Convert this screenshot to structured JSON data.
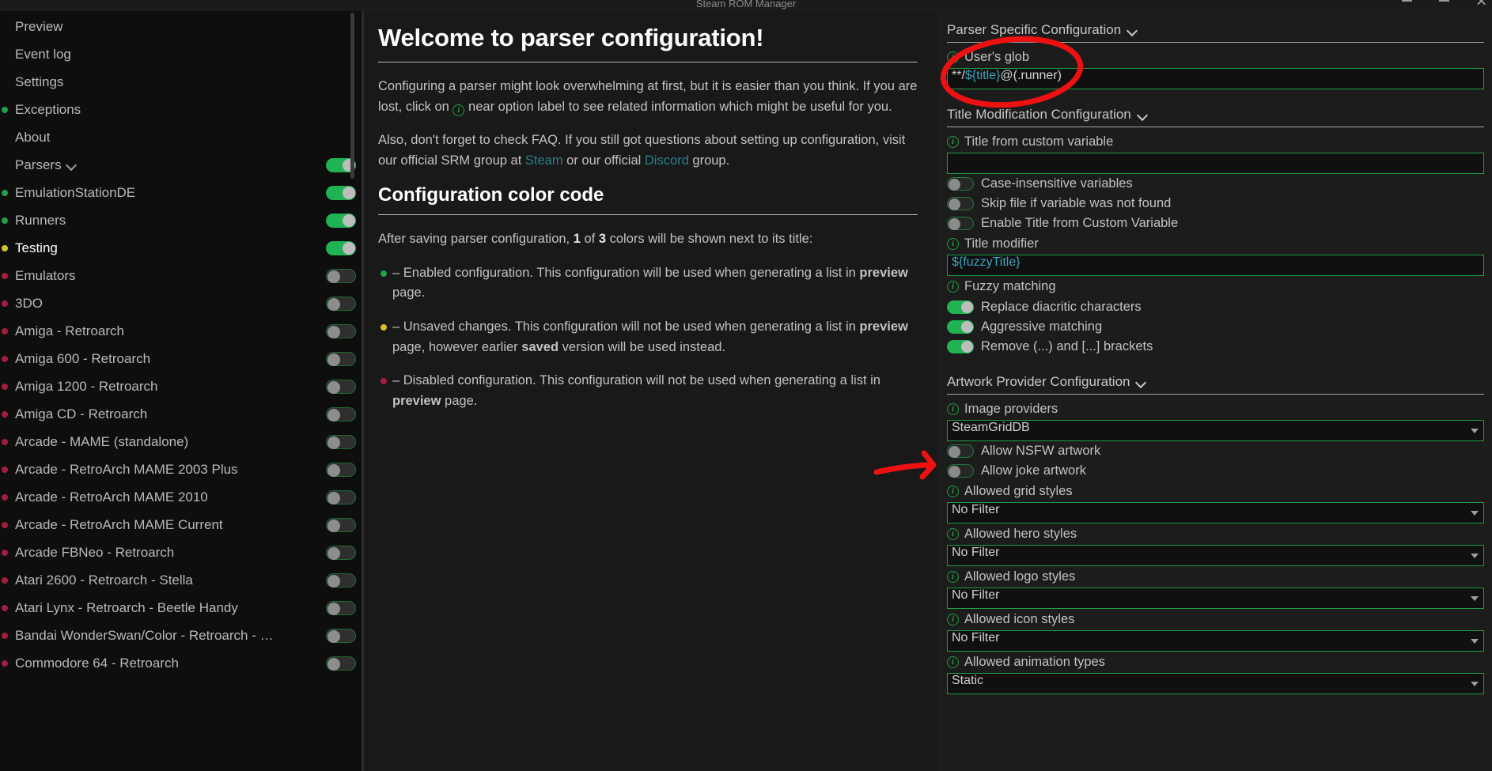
{
  "window": {
    "title": "Steam ROM Manager",
    "controls": [
      "minimize-button",
      "maximize-button",
      "close-button"
    ]
  },
  "sidebar": {
    "items": [
      {
        "label": "Preview",
        "dot": "none",
        "toggle": "none",
        "active": false
      },
      {
        "label": "Event log",
        "dot": "none",
        "toggle": "none",
        "active": false
      },
      {
        "label": "Settings",
        "dot": "none",
        "toggle": "none",
        "active": false
      },
      {
        "label": "Exceptions",
        "dot": "green",
        "toggle": "none",
        "active": false
      },
      {
        "label": "About",
        "dot": "none",
        "toggle": "none",
        "active": false
      },
      {
        "label": "Parsers",
        "dot": "none",
        "toggle": "on",
        "active": false,
        "chevron": true
      },
      {
        "label": "EmulationStationDE",
        "dot": "green",
        "toggle": "on",
        "active": false
      },
      {
        "label": "Runners",
        "dot": "green",
        "toggle": "on",
        "active": false
      },
      {
        "label": "Testing",
        "dot": "yellow",
        "toggle": "on",
        "active": true
      },
      {
        "label": "Emulators",
        "dot": "red",
        "toggle": "off",
        "active": false
      },
      {
        "label": "3DO",
        "dot": "red",
        "toggle": "off",
        "active": false
      },
      {
        "label": "Amiga - Retroarch",
        "dot": "red",
        "toggle": "off",
        "active": false
      },
      {
        "label": "Amiga 600 - Retroarch",
        "dot": "red",
        "toggle": "off",
        "active": false
      },
      {
        "label": "Amiga 1200 - Retroarch",
        "dot": "red",
        "toggle": "off",
        "active": false
      },
      {
        "label": "Amiga CD - Retroarch",
        "dot": "red",
        "toggle": "off",
        "active": false
      },
      {
        "label": "Arcade - MAME (standalone)",
        "dot": "red",
        "toggle": "off",
        "active": false
      },
      {
        "label": "Arcade - RetroArch MAME 2003 Plus",
        "dot": "red",
        "toggle": "off",
        "active": false
      },
      {
        "label": "Arcade - RetroArch MAME 2010",
        "dot": "red",
        "toggle": "off",
        "active": false
      },
      {
        "label": "Arcade - RetroArch MAME Current",
        "dot": "red",
        "toggle": "off",
        "active": false
      },
      {
        "label": "Arcade FBNeo - Retroarch",
        "dot": "red",
        "toggle": "off",
        "active": false
      },
      {
        "label": "Atari 2600 - Retroarch - Stella",
        "dot": "red",
        "toggle": "off",
        "active": false
      },
      {
        "label": "Atari Lynx - Retroarch - Beetle Handy",
        "dot": "red",
        "toggle": "off",
        "active": false
      },
      {
        "label": "Bandai WonderSwan/Color - Retroarch - …",
        "dot": "red",
        "toggle": "off",
        "active": false
      },
      {
        "label": "Commodore 64 - Retroarch",
        "dot": "red",
        "toggle": "off",
        "active": false
      }
    ]
  },
  "main": {
    "title": "Welcome to parser configuration!",
    "intro_a_1": "Configuring a parser might look overwhelming at first, but it is easier than you think. If you are lost, click on ",
    "intro_a_2": " near option label to see related information which might be useful for you.",
    "intro_b_1": "Also, don't forget to check FAQ. If you still got questions about setting up configuration, visit our official SRM group at ",
    "link_steam": "Steam",
    "intro_b_2": " or our official ",
    "link_discord": "Discord",
    "intro_b_3": " group.",
    "section2_title": "Configuration color code",
    "color_intro_1": "After saving parser configuration, ",
    "color_intro_count": "1",
    "color_intro_2": " of ",
    "color_intro_total": "3",
    "color_intro_3": " colors will be shown next to its title:",
    "cc_green_1": " – Enabled configuration. This configuration will be used when generating a list in ",
    "cc_green_bold": "preview",
    "cc_green_2": " page.",
    "cc_yellow_1": " – Unsaved changes. This configuration will not be used when generating a list in ",
    "cc_yellow_bold": "preview",
    "cc_yellow_2": " page, however earlier ",
    "cc_yellow_bold2": "saved",
    "cc_yellow_3": " version will be used instead.",
    "cc_red_1": " – Disabled configuration. This configuration will not be used when generating a list in ",
    "cc_red_bold": "preview",
    "cc_red_2": " page."
  },
  "right": {
    "parser_section": {
      "title": "Parser Specific Configuration",
      "glob_label": "User's glob",
      "glob_value_pre": "**/",
      "glob_value_token": "${title}",
      "glob_value_post": "@(.runner)"
    },
    "title_section": {
      "title": "Title Modification Configuration",
      "custom_var_label": "Title from custom variable",
      "custom_var_value": "",
      "toggles": [
        {
          "label": "Case-insensitive variables",
          "state": "off"
        },
        {
          "label": "Skip file if variable was not found",
          "state": "off"
        },
        {
          "label": "Enable Title from Custom Variable",
          "state": "off"
        }
      ],
      "title_modifier_label": "Title modifier",
      "title_modifier_value": "${fuzzyTitle}",
      "fuzzy_label": "Fuzzy matching",
      "fuzzy_toggles": [
        {
          "label": "Replace diacritic characters",
          "state": "on"
        },
        {
          "label": "Aggressive matching",
          "state": "on"
        },
        {
          "label": "Remove (...) and [...] brackets",
          "state": "on"
        }
      ]
    },
    "artwork_section": {
      "title": "Artwork Provider Configuration",
      "image_providers_label": "Image providers",
      "image_providers_value": "SteamGridDB",
      "toggles": [
        {
          "label": "Allow NSFW artwork",
          "state": "off"
        },
        {
          "label": "Allow joke artwork",
          "state": "off"
        }
      ],
      "selects": [
        {
          "label": "Allowed grid styles",
          "value": "No Filter"
        },
        {
          "label": "Allowed hero styles",
          "value": "No Filter"
        },
        {
          "label": "Allowed logo styles",
          "value": "No Filter"
        },
        {
          "label": "Allowed icon styles",
          "value": "No Filter"
        },
        {
          "label": "Allowed animation types",
          "value": "Static"
        }
      ]
    }
  },
  "colors": {
    "accent_green": "#21b353",
    "border_green": "#1f9b42",
    "dot_green": "#20a04a",
    "dot_yellow": "#d6c32a",
    "dot_red": "#a51c3c",
    "annotation_red": "#ee1111",
    "link_blue": "#2a7e8f",
    "token_blue": "#3da2ba"
  },
  "annotations": [
    {
      "name": "glob-field-highlight-ellipse",
      "shape": "ellipse",
      "color": "#ee1111"
    },
    {
      "name": "image-providers-arrow",
      "shape": "arrow",
      "color": "#ee1111"
    }
  ]
}
